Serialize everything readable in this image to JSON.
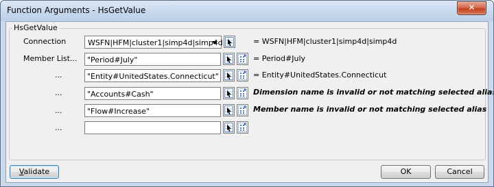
{
  "window": {
    "title": "Function Arguments - HsGetValue",
    "close_glyph": "✕"
  },
  "group": {
    "legend": "HsGetValue"
  },
  "connection": {
    "label": "Connection",
    "value": "WSFN|HFM|cluster1|simp4d|simp4d",
    "result": "= WSFN|HFM|cluster1|simp4d|simp4d"
  },
  "members": [
    {
      "label": "Member List...",
      "value": "\"Period#July\"",
      "result": "= Period#July",
      "error": false
    },
    {
      "label": "...",
      "value": "\"Entity#UnitedStates.Connecticut\"",
      "result": "= Entity#UnitedStates.Connecticut",
      "error": false
    },
    {
      "label": "...",
      "value": "\"Accounts#Cash\"",
      "result": "Dimension name is invalid or not matching selected alias",
      "error": true
    },
    {
      "label": "...",
      "value": "\"Flow#Increase\"",
      "result": "Member name is invalid or not matching selected alias",
      "error": true
    },
    {
      "label": "...",
      "value": "",
      "result": "",
      "error": false
    }
  ],
  "icons": {
    "select": "select-cell-icon",
    "member": "member-selector-icon"
  },
  "buttons": {
    "validate": "Validate",
    "ok": "OK",
    "cancel": "Cancel"
  }
}
